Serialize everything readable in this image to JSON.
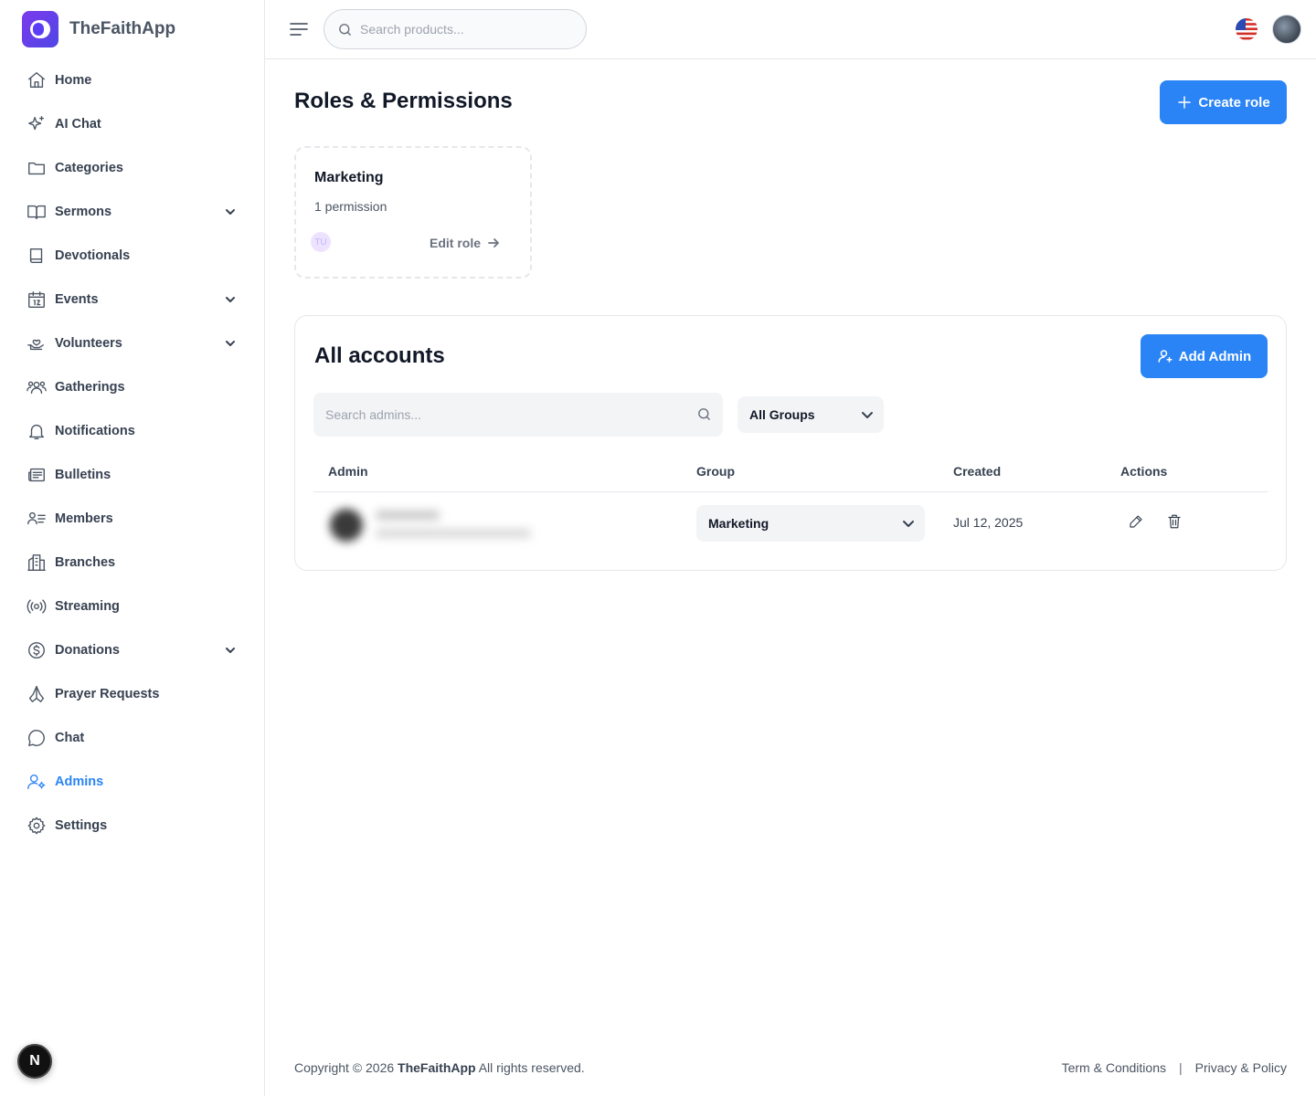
{
  "brand": {
    "name": "TheFaithApp"
  },
  "sidebar": {
    "items": [
      {
        "label": "Home",
        "icon": "home-icon"
      },
      {
        "label": "AI Chat",
        "icon": "sparkle-icon"
      },
      {
        "label": "Categories",
        "icon": "folder-icon"
      },
      {
        "label": "Sermons",
        "icon": "book-open-icon"
      },
      {
        "label": "Devotionals",
        "icon": "book-icon"
      },
      {
        "label": "Events",
        "icon": "calendar-icon"
      },
      {
        "label": "Volunteers",
        "icon": "hand-heart-icon"
      },
      {
        "label": "Gatherings",
        "icon": "users-icon"
      },
      {
        "label": "Notifications",
        "icon": "bell-icon"
      },
      {
        "label": "Bulletins",
        "icon": "newspaper-icon"
      },
      {
        "label": "Members",
        "icon": "member-list-icon"
      },
      {
        "label": "Branches",
        "icon": "building-icon"
      },
      {
        "label": "Streaming",
        "icon": "broadcast-icon"
      },
      {
        "label": "Donations",
        "icon": "dollar-icon"
      },
      {
        "label": "Prayer Requests",
        "icon": "praying-hands-icon"
      },
      {
        "label": "Chat",
        "icon": "chat-bubble-icon"
      },
      {
        "label": "Admins",
        "icon": "user-gear-icon"
      },
      {
        "label": "Settings",
        "icon": "gear-icon"
      }
    ],
    "next_badge": "N"
  },
  "header": {
    "search_placeholder": "Search products..."
  },
  "main": {
    "title": "Roles & Permissions",
    "create_role_label": "Create role",
    "role_card": {
      "name": "Marketing",
      "permissions": "1 permission",
      "avatar_initials": "TU",
      "edit_label": "Edit role"
    },
    "accounts": {
      "title": "All accounts",
      "add_admin_label": "Add Admin",
      "search_placeholder": "Search admins...",
      "group_filter": "All Groups",
      "columns": [
        "Admin",
        "Group",
        "Created",
        "Actions"
      ],
      "rows": [
        {
          "group": "Marketing",
          "created": "Jul 12, 2025"
        }
      ]
    }
  },
  "footer": {
    "copyright_prefix": "Copyright © 2026",
    "copyright_brand": "TheFaithApp",
    "copyright_suffix": "All rights reserved.",
    "terms": "Term & Conditions",
    "separator": "|",
    "privacy": "Privacy & Policy"
  },
  "colors": {
    "accent": "#2b84f5",
    "brand": "#5b3df5"
  }
}
